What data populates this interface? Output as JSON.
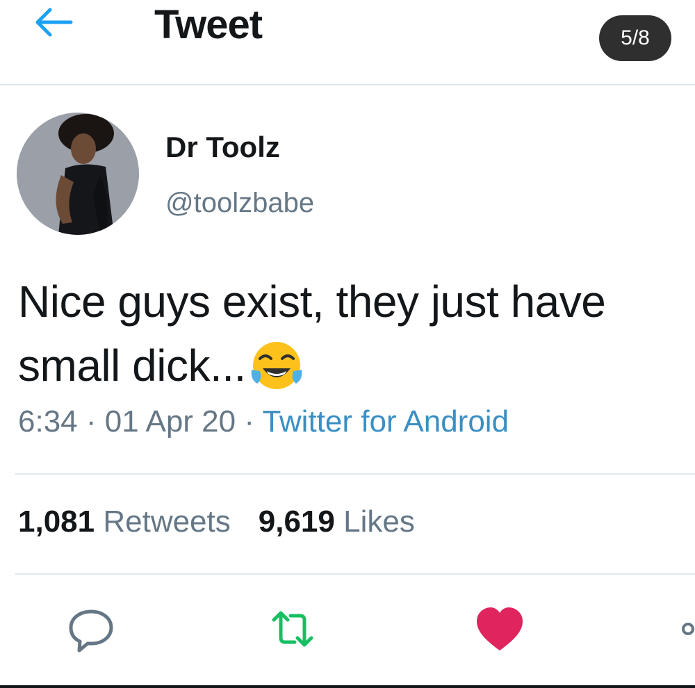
{
  "header": {
    "title": "Tweet",
    "counter": "5/8"
  },
  "user": {
    "display_name": "Dr Toolz",
    "handle": "@toolzbabe"
  },
  "tweet": {
    "line1": "Nice guys exist, they just have",
    "line2": "small dick...",
    "emoji": "face-with-tears-of-joy-icon"
  },
  "meta": {
    "time": "6:34",
    "separator": " · ",
    "date": "01 Apr 20",
    "source": "Twitter for Android"
  },
  "stats": {
    "retweets_count": "1,081",
    "retweets_label": "Retweets",
    "likes_count": "9,619",
    "likes_label": "Likes"
  },
  "colors": {
    "accent": "#1da1f2",
    "retweet_green": "#17bf63",
    "like_red": "#e0245e",
    "muted": "#657786",
    "badge_bg": "#2f2f2f"
  }
}
